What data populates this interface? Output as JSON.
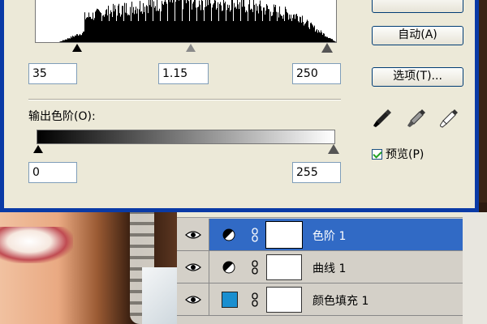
{
  "dialog": {
    "input_levels": {
      "black": "35",
      "gamma": "1.15",
      "white": "250"
    },
    "output_label": "输出色阶(O):",
    "output_levels": {
      "black": "0",
      "white": "255"
    },
    "buttons": {
      "auto": "自动(A)",
      "options": "选项(T)..."
    },
    "preview_label": "预览(P)",
    "preview_checked": true,
    "slider_positions": {
      "input_black": 35,
      "input_gamma_mid": 142,
      "input_white": 250,
      "output_black": 0,
      "output_white": 255
    }
  },
  "layers": [
    {
      "name": "色阶 1",
      "type": "levels-adjustment",
      "selected": true,
      "icon": "adjustment-circle-icon"
    },
    {
      "name": "曲线 1",
      "type": "curves-adjustment",
      "selected": false,
      "icon": "adjustment-circle-icon"
    },
    {
      "name": "颜色填充 1",
      "type": "color-fill",
      "selected": false,
      "fill_color": "#1a8fd0"
    }
  ],
  "colors": {
    "selected_row": "#316ac5",
    "dialog_bg": "#ece9d8",
    "dialog_border": "#0a3aa6"
  }
}
